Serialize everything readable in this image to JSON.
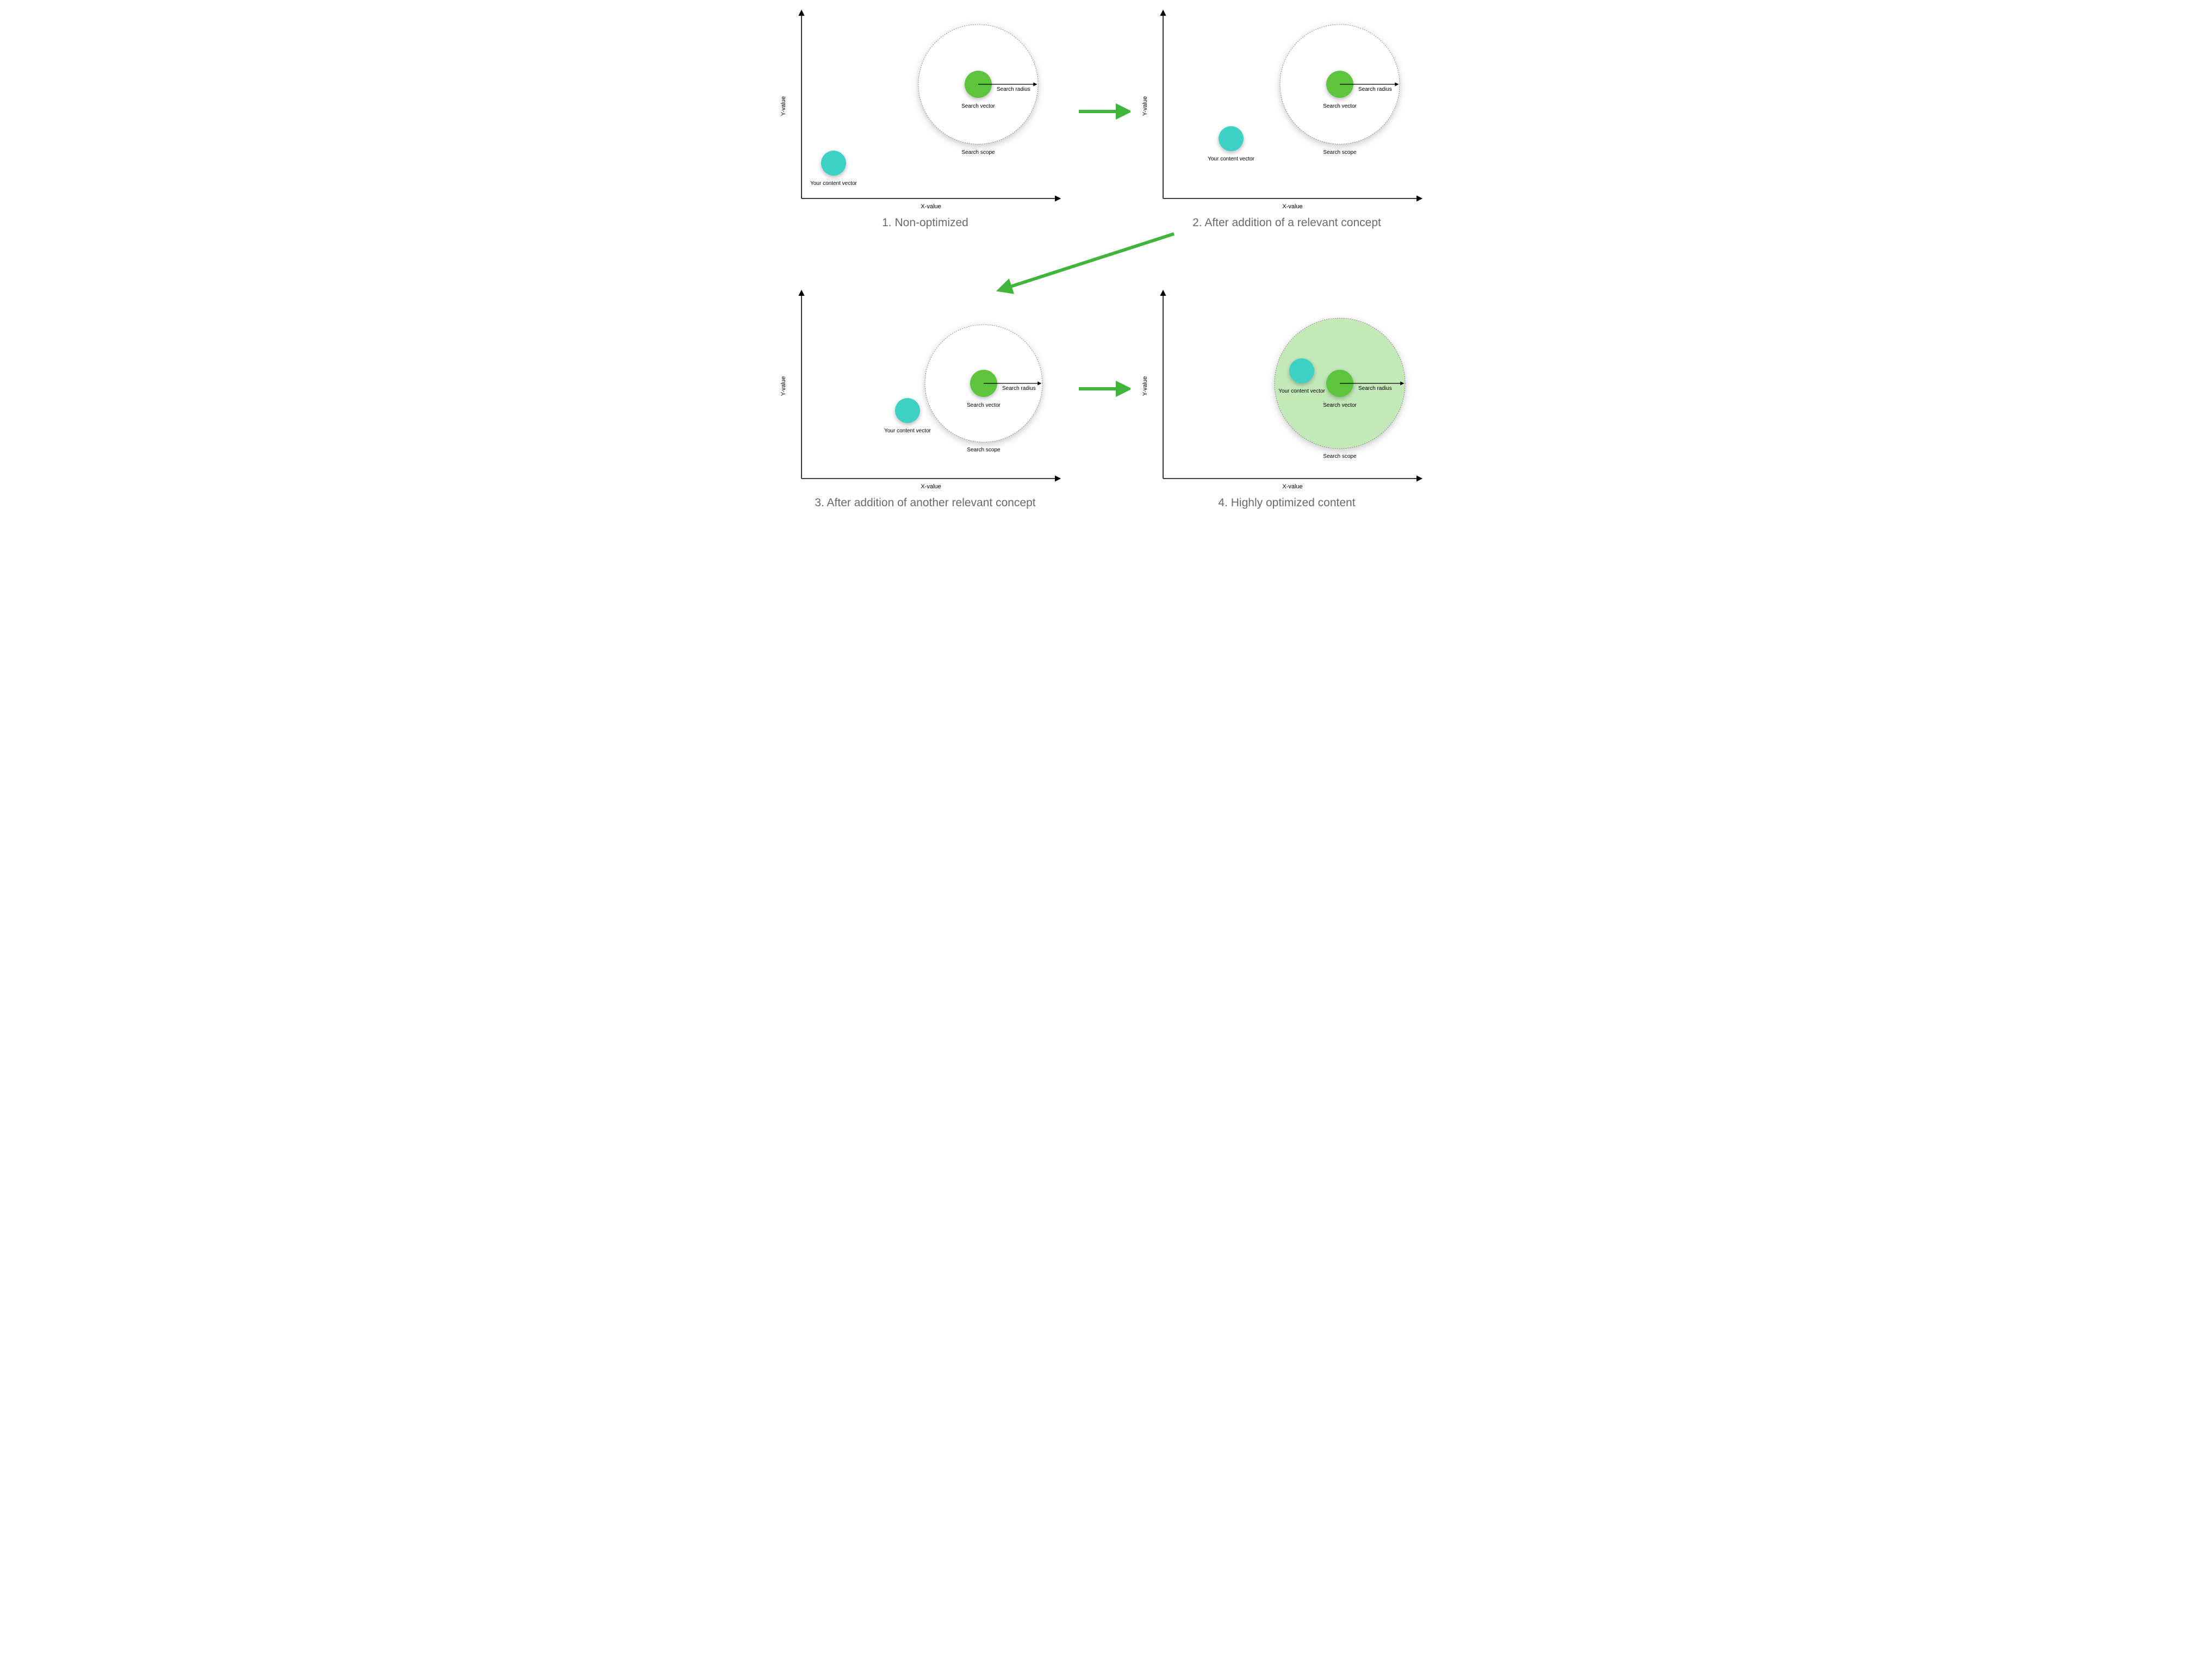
{
  "axis": {
    "x": "X-value",
    "y": "Y-value"
  },
  "labels": {
    "search_vector": "Search vector",
    "search_scope": "Search scope",
    "search_radius": "Search radius",
    "your_content_vector": "Your content vector"
  },
  "captions": {
    "p1": "1. Non-optimized",
    "p2": "2. After addition of a relevant concept",
    "p3": "3. After addition of another relevant concept",
    "p4": "4. Highly optimized content"
  },
  "chart_data": [
    {
      "panel": 1,
      "title": "Non-optimized",
      "xlabel": "X-value",
      "ylabel": "Y-value",
      "xlim": [
        0,
        1
      ],
      "ylim": [
        0,
        1
      ],
      "search_vector": {
        "x": 0.68,
        "y": 0.62
      },
      "search_radius": 0.22,
      "scope_fill": "none",
      "content_vector": {
        "x": 0.15,
        "y": 0.2
      },
      "content_inside_scope": false
    },
    {
      "panel": 2,
      "title": "After addition of a relevant concept",
      "xlabel": "X-value",
      "ylabel": "Y-value",
      "xlim": [
        0,
        1
      ],
      "ylim": [
        0,
        1
      ],
      "search_vector": {
        "x": 0.68,
        "y": 0.62
      },
      "search_radius": 0.22,
      "scope_fill": "none",
      "content_vector": {
        "x": 0.28,
        "y": 0.38
      },
      "content_inside_scope": false
    },
    {
      "panel": 3,
      "title": "After addition of another relevant concept",
      "xlabel": "X-value",
      "ylabel": "Y-value",
      "xlim": [
        0,
        1
      ],
      "ylim": [
        0,
        1
      ],
      "search_vector": {
        "x": 0.68,
        "y": 0.5
      },
      "search_radius": 0.22,
      "scope_fill": "none",
      "content_vector": {
        "x": 0.43,
        "y": 0.4
      },
      "content_inside_scope": false
    },
    {
      "panel": 4,
      "title": "Highly optimized content",
      "xlabel": "X-value",
      "ylabel": "Y-value",
      "xlim": [
        0,
        1
      ],
      "ylim": [
        0,
        1
      ],
      "search_vector": {
        "x": 0.67,
        "y": 0.5
      },
      "search_radius": 0.24,
      "scope_fill": "light-green",
      "content_vector": {
        "x": 0.53,
        "y": 0.56
      },
      "content_inside_scope": true
    }
  ],
  "colors": {
    "search_vector_fill": "#5bc43e",
    "content_vector_fill": "#3ed1c5",
    "scope_green_fill": "#c4e9b9",
    "arrow_green": "#3fb63b",
    "axis": "#000000",
    "caption": "#6a6a6a"
  }
}
